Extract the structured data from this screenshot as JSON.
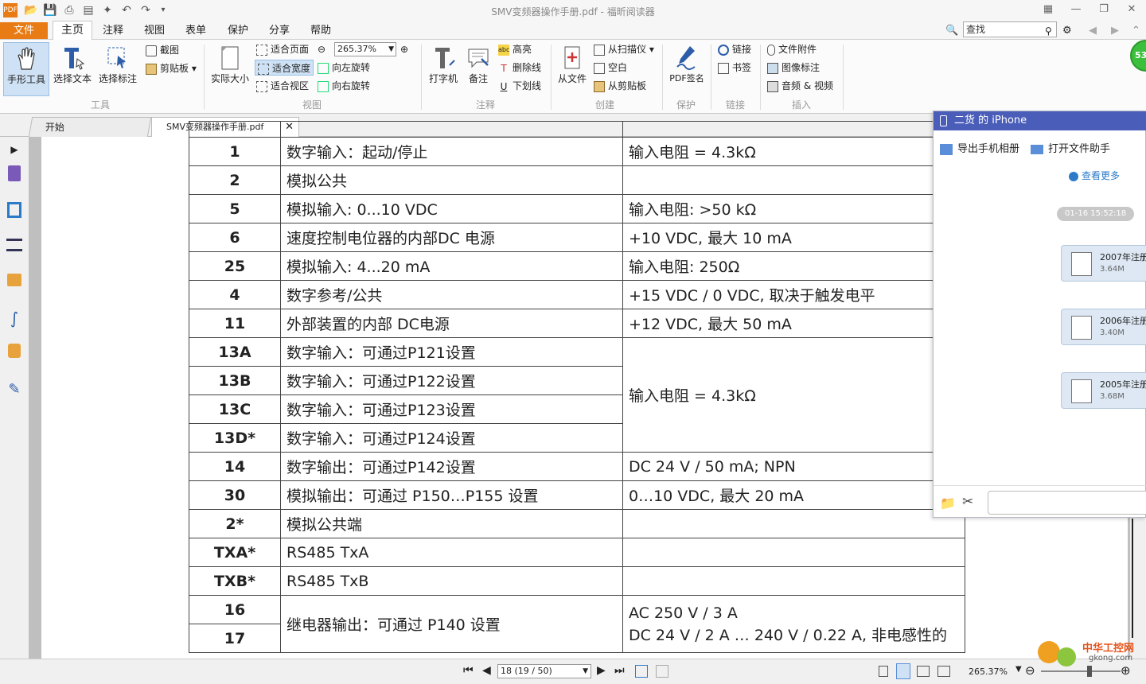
{
  "window": {
    "title": "SMV变频器操作手册.pdf - 福昕阅读器"
  },
  "menu": {
    "file": "文件",
    "home": "主页",
    "comment": "注释",
    "view": "视图",
    "form": "表单",
    "protect": "保护",
    "share": "分享",
    "help": "帮助"
  },
  "search": {
    "placeholder": "查找"
  },
  "ribbon": {
    "hand_tool": "手形工具",
    "select_text": "选择文本",
    "select_annot": "选择标注",
    "screenshot": "截图",
    "clipboard": "剪贴板",
    "group_tools": "工具",
    "actual_size": "实际大小",
    "fit_page": "适合页面",
    "fit_width": "适合宽度",
    "fit_view": "适合视区",
    "zoom_value": "265.37%",
    "rotate_left": "向左旋转",
    "rotate_right": "向右旋转",
    "group_view": "视图",
    "typewriter": "打字机",
    "note": "备注",
    "highlight": "高亮",
    "strikeout": "删除线",
    "underline": "下划线",
    "group_comment": "注释",
    "from_file": "从文件",
    "from_scanner": "从扫描仪",
    "blank": "空白",
    "from_clipboard": "从剪贴板",
    "group_create": "创建",
    "pdf_sign": "PDF签名",
    "group_protect": "保护",
    "link": "链接",
    "bookmark": "书签",
    "group_link": "链接",
    "file_attach": "文件附件",
    "image_annot": "图像标注",
    "audio_video": "音频 & 视频",
    "group_insert": "插入"
  },
  "tabs": {
    "start": "开始",
    "doc": "SMV变频器操作手册.pdf"
  },
  "table": {
    "rows": [
      {
        "pin": "1",
        "func": "数字输入：起动/停止",
        "spec": "输入电阻 = 4.3kΩ"
      },
      {
        "pin": "2",
        "func": "模拟公共",
        "spec": ""
      },
      {
        "pin": "5",
        "func": "模拟输入: 0...10 VDC",
        "spec": "输入电阻: >50 kΩ"
      },
      {
        "pin": "6",
        "func": "速度控制电位器的内部DC 电源",
        "spec": "+10 VDC, 最大  10 mA"
      },
      {
        "pin": "25",
        "func": "模拟输入: 4...20 mA",
        "spec": "输入电阻: 250Ω"
      },
      {
        "pin": "4",
        "func": "数字参考/公共",
        "spec": "+15 VDC / 0 VDC, 取决于触发电平"
      },
      {
        "pin": "11",
        "func": "外部装置的内部  DC电源",
        "spec": "+12 VDC, 最大  50 mA"
      },
      {
        "pin": "13A",
        "func": "数字输入：可通过P121设置",
        "spec": ""
      },
      {
        "pin": "13B",
        "func": "数字输入：可通过P122设置",
        "spec": ""
      },
      {
        "pin": "13C",
        "func": "数字输入：可通过P123设置",
        "spec": ""
      },
      {
        "pin": "13D*",
        "func": "数字输入：可通过P124设置",
        "spec": ""
      },
      {
        "pin": "14",
        "func": "数字输出：可通过P142设置",
        "spec": "DC 24 V / 50 mA; NPN"
      },
      {
        "pin": "30",
        "func": "模拟输出：可通过 P150…P155 设置",
        "spec": "0…10 VDC, 最大 20 mA"
      },
      {
        "pin": "2*",
        "func": "模拟公共端",
        "spec": ""
      },
      {
        "pin": "TXA*",
        "func": "RS485  TxA",
        "spec": ""
      },
      {
        "pin": "TXB*",
        "func": "RS485  TxB",
        "spec": ""
      }
    ],
    "merged_spec": "输入电阻 = 4.3kΩ",
    "relay_pins": [
      "16",
      "17"
    ],
    "relay_func": "继电器输出：可通过 P140 设置",
    "relay_spec_1": "AC 250 V / 3 A",
    "relay_spec_2": "DC 24 V / 2 A … 240 V / 0.22 A, 非电感性的"
  },
  "status": {
    "page_field": "18 (19 / 50)",
    "zoom": "265.37%"
  },
  "phone": {
    "title": "二货 的 iPhone",
    "export_album": "导出手机相册",
    "open_assistant": "打开文件助手",
    "see_more": "查看更多",
    "timestamp": "01-16 15:52:18",
    "files": [
      {
        "name": "2007年注册",
        "size": "3.64M"
      },
      {
        "name": "2006年注册",
        "size": "3.40M"
      },
      {
        "name": "2005年注册",
        "size": "3.68M"
      }
    ]
  },
  "watermark": {
    "text": "中华工控网",
    "sub": "gkong.com"
  },
  "green_badge": "53",
  "colors": {
    "accent": "#e87b13",
    "phone_header": "#4a5db8"
  }
}
